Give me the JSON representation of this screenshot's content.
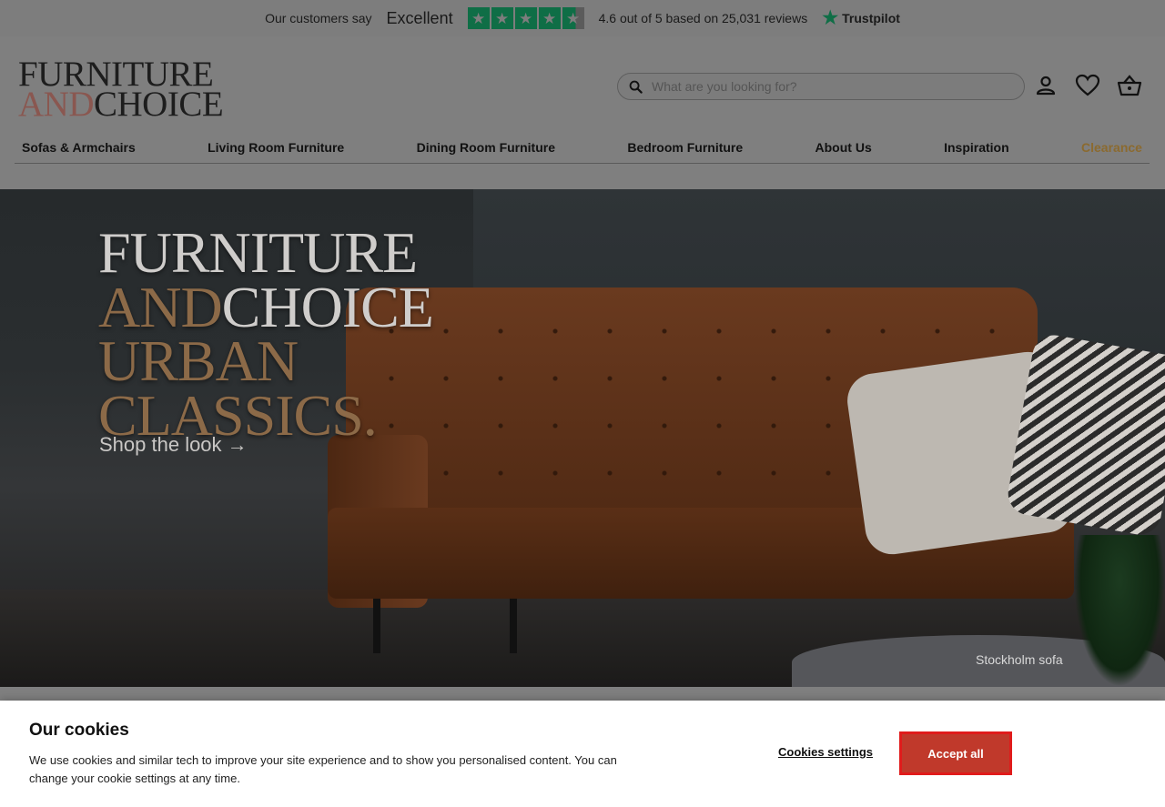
{
  "trustbar": {
    "intro": "Our customers say",
    "rating_word": "Excellent",
    "stars": 4.5,
    "summary": "4.6 out of 5 based on 25,031 reviews",
    "brand": "Trustpilot",
    "star_color": "#0f6e46"
  },
  "header": {
    "logo": {
      "line1": "FURNITURE",
      "and": "AND",
      "choice": "CHOICE"
    },
    "search": {
      "placeholder": "What are you looking for?",
      "value": ""
    },
    "icons": [
      "account-icon",
      "wishlist-icon",
      "basket-icon"
    ]
  },
  "nav": {
    "items": [
      {
        "label": "Sofas & Armchairs"
      },
      {
        "label": "Living Room Furniture"
      },
      {
        "label": "Dining Room Furniture"
      },
      {
        "label": "Bedroom Furniture"
      },
      {
        "label": "About Us"
      },
      {
        "label": "Inspiration"
      },
      {
        "label": "Clearance"
      }
    ],
    "clearance_color": "#8b6a2f"
  },
  "hero": {
    "lines": [
      "FURNITURE",
      "AND",
      "CHOICE",
      "URBAN",
      "CLASSICS",
      "."
    ],
    "cta": "Shop the look →",
    "caption": "Stockholm sofa",
    "accent_color": "#8c6a48"
  },
  "cookies": {
    "title": "Our cookies",
    "text": "We use cookies and similar tech to improve your site experience and to show you personalised content. You can change your cookie settings at any time.",
    "settings_label": "Cookies settings",
    "accept_label": "Accept all",
    "accept_color": "#c0392b"
  }
}
